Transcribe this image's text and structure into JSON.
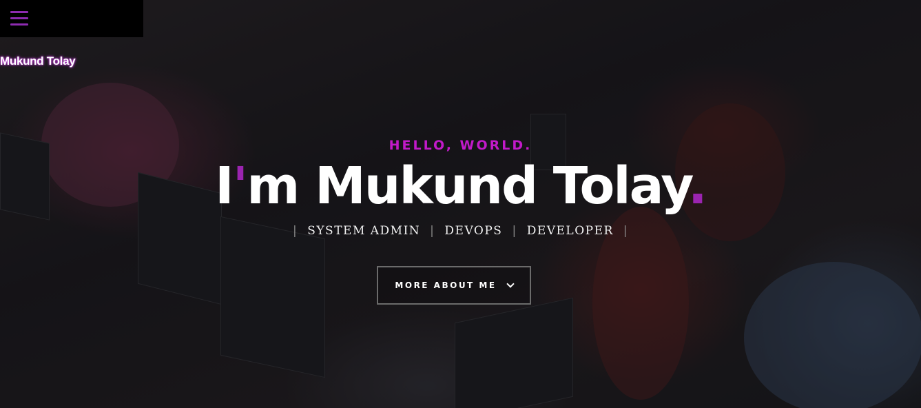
{
  "nav": {
    "menu_icon": "hamburger-menu-icon",
    "menu_color": "#8d2bb0"
  },
  "brand": {
    "name": "Mukund Tolay"
  },
  "intro": {
    "greeting": "HELLO, WORLD.",
    "headline_prefix": "I",
    "headline_apostrophe": "'",
    "headline_name": "m Mukund Tolay",
    "headline_dot": ".",
    "roles": [
      "SYSTEM ADMIN",
      "DEVOPS",
      "DEVELOPER"
    ],
    "cta_label": "MORE ABOUT ME",
    "cta_icon": "chevron-down-icon"
  },
  "colors": {
    "accent": "#c21ac9",
    "accent_dark": "#9b24b0",
    "text": "#ffffff"
  }
}
